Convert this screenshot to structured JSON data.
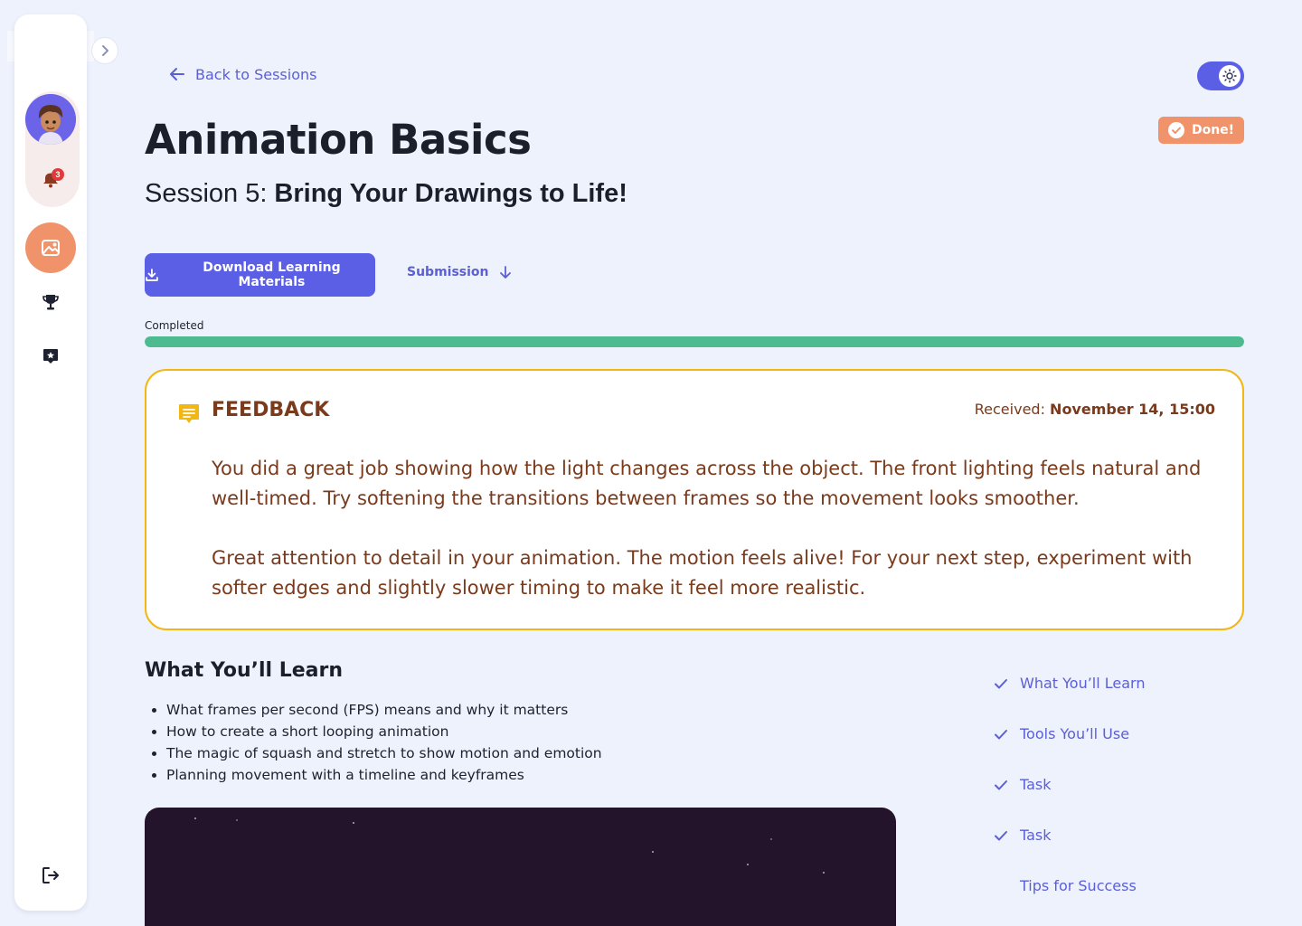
{
  "header": {
    "back_label": "Back to Sessions",
    "done_label": "Done!",
    "title": "Animation Basics",
    "session_prefix": "Session 5:",
    "session_name": "Bring Your Drawings to Life!"
  },
  "sidebar": {
    "notification_count": "3"
  },
  "actions": {
    "download_label": "Download Learning Materials",
    "submission_label": "Submission"
  },
  "progress": {
    "label": "Completed",
    "value": 1.0
  },
  "feedback": {
    "title": "FEEDBACK",
    "received_label": "Received:",
    "received_date": "November 14, 15:00",
    "paragraphs": [
      "You did a great job showing how the light changes across the object. The front lighting feels natural and well-timed. Try softening the transitions between frames so the movement looks smoother.",
      "Great attention to detail in your animation. The motion feels alive! For your next step, experiment with softer edges and slightly slower timing to make it feel more realistic."
    ]
  },
  "learn": {
    "title": "What You’ll Learn",
    "items": [
      "What frames per second (FPS) means and why it matters",
      "How to create a short looping animation",
      "The magic of squash and stretch to show motion and emotion",
      "Planning movement with a timeline and keyframes"
    ]
  },
  "toc": [
    {
      "label": "What You’ll Learn",
      "checked": true
    },
    {
      "label": "Tools You’ll Use",
      "checked": true
    },
    {
      "label": "Task",
      "checked": true
    },
    {
      "label": "Task",
      "checked": true
    },
    {
      "label": "Tips for Success",
      "checked": false
    }
  ],
  "colors": {
    "accent": "#5b5fe6",
    "done": "#f0936a",
    "progress": "#4dbb8f",
    "feedback_border": "#f1b713",
    "feedback_text": "#7a3a1c"
  }
}
